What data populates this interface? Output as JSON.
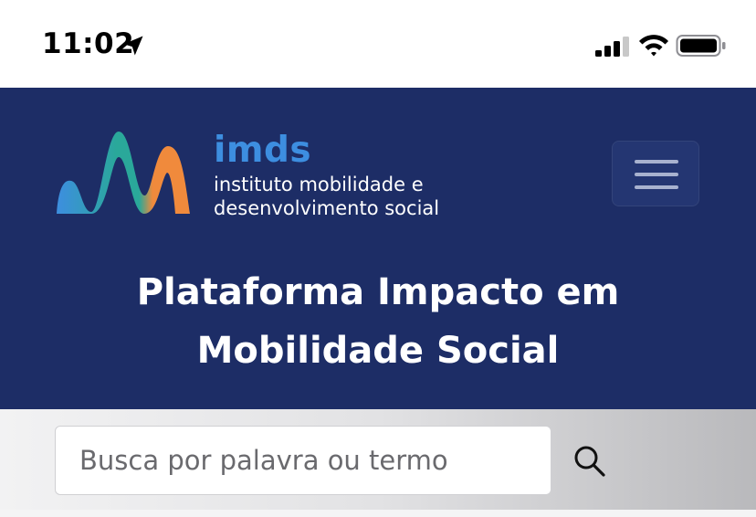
{
  "status_bar": {
    "time": "11:02",
    "icons": [
      "location-arrow-icon",
      "signal-icon",
      "wifi-icon",
      "battery-icon"
    ]
  },
  "header": {
    "logo_name": "imds",
    "logo_subtitle_line1": "instituto mobilidade e",
    "logo_subtitle_line2": "desenvolvimento social",
    "title_line1": "Plataforma Impacto em",
    "title_line2": "Mobilidade Social",
    "menu_icon": "hamburger-menu-icon"
  },
  "search": {
    "placeholder": "Busca por palavra ou termo",
    "value": "",
    "icon": "search-icon"
  },
  "colors": {
    "header_bg": "#1d2d66",
    "logo_blue": "#3d8ee0",
    "logo_teal": "#2aa89a",
    "logo_orange": "#f08a3c"
  }
}
